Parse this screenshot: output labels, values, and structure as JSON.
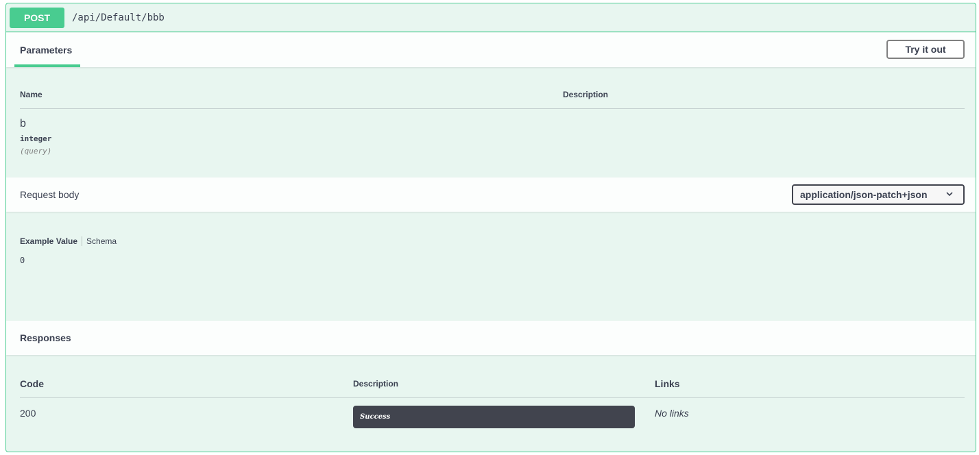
{
  "summary": {
    "method": "POST",
    "path": "/api/Default/bbb"
  },
  "parameters": {
    "tab_label": "Parameters",
    "try_button": "Try it out",
    "col_name": "Name",
    "col_description": "Description",
    "items": [
      {
        "name": "b",
        "type": "integer",
        "in": "(query)"
      }
    ]
  },
  "request_body": {
    "title": "Request body",
    "content_type": "application/json-patch+json",
    "tab_example": "Example Value",
    "tab_schema": "Schema",
    "example_value": "0"
  },
  "responses": {
    "title": "Responses",
    "col_code": "Code",
    "col_description": "Description",
    "col_links": "Links",
    "rows": [
      {
        "code": "200",
        "description": "Success",
        "links": "No links"
      }
    ]
  },
  "colors": {
    "post_green": "#49cc90",
    "block_bg": "#e8f6f0",
    "dark_box": "#41444e",
    "text": "#3b4151"
  },
  "icons": {
    "select_chevron": "chevron-down-icon"
  }
}
